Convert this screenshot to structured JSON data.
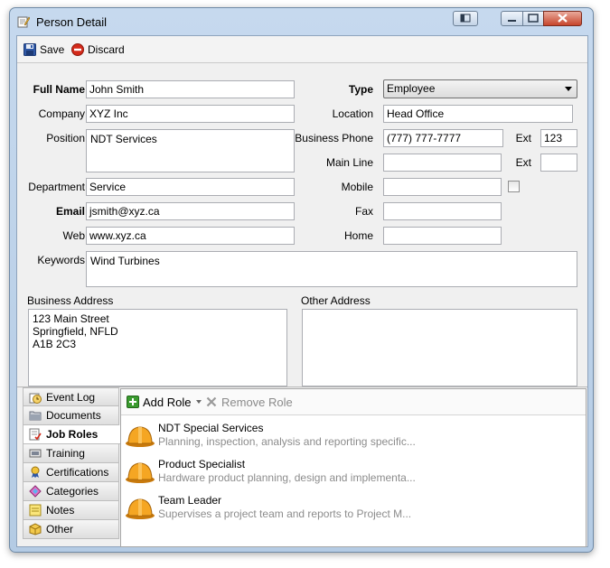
{
  "window": {
    "title": "Person Detail"
  },
  "toolbar": {
    "save_label": "Save",
    "discard_label": "Discard"
  },
  "form": {
    "full_name": {
      "label": "Full Name",
      "value": "John Smith"
    },
    "company": {
      "label": "Company",
      "value": "XYZ Inc"
    },
    "position": {
      "label": "Position",
      "value": "NDT Services"
    },
    "department": {
      "label": "Department",
      "value": "Service"
    },
    "email": {
      "label": "Email",
      "value": "jsmith@xyz.ca"
    },
    "web": {
      "label": "Web",
      "value": "www.xyz.ca"
    },
    "keywords": {
      "label": "Keywords",
      "value": "Wind Turbines"
    },
    "type": {
      "label": "Type",
      "value": "Employee"
    },
    "location": {
      "label": "Location",
      "value": "Head Office"
    },
    "business_phone": {
      "label": "Business Phone",
      "value": "(777) 777-7777"
    },
    "ext1": {
      "label": "Ext",
      "value": "123"
    },
    "main_line": {
      "label": "Main Line",
      "value": ""
    },
    "ext2": {
      "label": "Ext",
      "value": ""
    },
    "mobile": {
      "label": "Mobile",
      "value": ""
    },
    "fax": {
      "label": "Fax",
      "value": ""
    },
    "home": {
      "label": "Home",
      "value": ""
    },
    "business_address": {
      "label": "Business Address",
      "value": "123 Main Street\nSpringfield, NFLD\nA1B 2C3"
    },
    "other_address": {
      "label": "Other Address",
      "value": ""
    }
  },
  "nav": {
    "items": [
      {
        "label": "Event Log",
        "icon": "clock-icon"
      },
      {
        "label": "Documents",
        "icon": "folder-icon"
      },
      {
        "label": "Job Roles",
        "icon": "job-roles-icon"
      },
      {
        "label": "Training",
        "icon": "training-icon"
      },
      {
        "label": "Certifications",
        "icon": "certificate-icon"
      },
      {
        "label": "Categories",
        "icon": "categories-icon"
      },
      {
        "label": "Notes",
        "icon": "notes-icon"
      },
      {
        "label": "Other",
        "icon": "box-icon"
      }
    ],
    "active": "Job Roles"
  },
  "panel": {
    "add_role_label": "Add Role",
    "remove_role_label": "Remove Role",
    "roles": [
      {
        "name": "NDT Special Services",
        "description": "Planning, inspection, analysis and reporting specific..."
      },
      {
        "name": "Product Specialist",
        "description": "Hardware product planning, design and implementa..."
      },
      {
        "name": "Team Leader",
        "description": "Supervises a project team and reports to Project M..."
      }
    ]
  },
  "colors": {
    "accent_frame": "#b4cbe4",
    "hat_orange": "#f5a623",
    "add_green": "#3a9b2f",
    "discard_red": "#d42a1a"
  }
}
